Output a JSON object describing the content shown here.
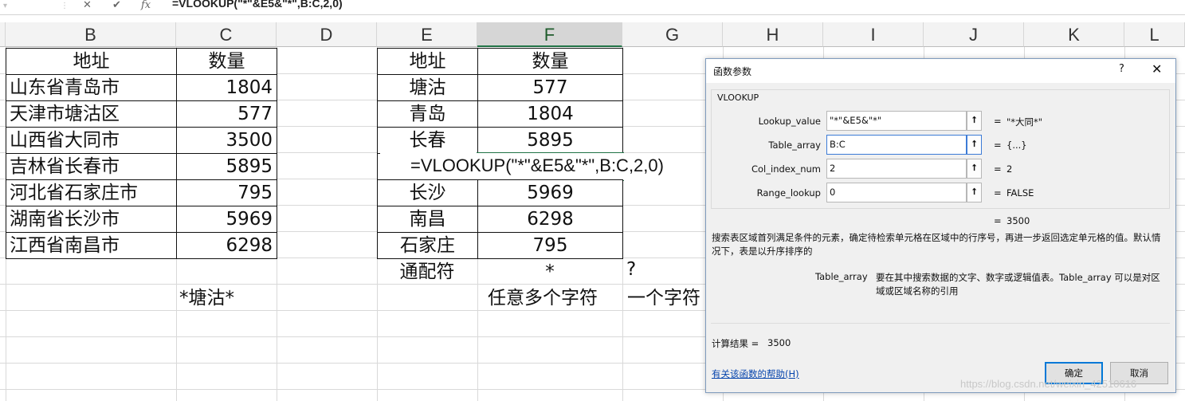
{
  "formula_bar": {
    "cancel_icon": "✕",
    "enter_icon": "✔",
    "fx_label": "fx",
    "formula": "=VLOOKUP(\"*\"&E5&\"*\",B:C,2,0)"
  },
  "columns": [
    "B",
    "C",
    "D",
    "E",
    "F",
    "G",
    "H",
    "I",
    "J",
    "K",
    "L"
  ],
  "table1": {
    "headers": [
      "地址",
      "数量"
    ],
    "rows": [
      [
        "山东省青岛市",
        "1804"
      ],
      [
        "天津市塘沽区",
        "577"
      ],
      [
        "山西省大同市",
        "3500"
      ],
      [
        "吉林省长春市",
        "5895"
      ],
      [
        "河北省石家庄市",
        "795"
      ],
      [
        "湖南省长沙市",
        "5969"
      ],
      [
        "江西省南昌市",
        "6298"
      ]
    ]
  },
  "table2": {
    "headers": [
      "地址",
      "数量"
    ],
    "rows": [
      [
        "塘沽",
        "577"
      ],
      [
        "青岛",
        "1804"
      ],
      [
        "长春",
        "5895"
      ],
      [
        "",
        "=VLOOKUP(\"*\"&E5&\"*\",B:C,2,0)"
      ],
      [
        "长沙",
        "5969"
      ],
      [
        "南昌",
        "6298"
      ],
      [
        "石家庄",
        "795"
      ]
    ]
  },
  "notes": {
    "wildcard_label": "通配符",
    "star": "*",
    "question": "?",
    "star_example": "*塘沽*",
    "star_meaning": "任意多个字符",
    "question_meaning": "一个字符"
  },
  "dialog": {
    "title": "函数参数",
    "help_icon": "?",
    "close_icon": "✕",
    "function_name": "VLOOKUP",
    "args": [
      {
        "label": "Lookup_value",
        "input": "\"*\"&E5&\"*\"",
        "eq": "=",
        "value": "\"*大同*\""
      },
      {
        "label": "Table_array",
        "input": "B:C",
        "eq": "=",
        "value": "{...}"
      },
      {
        "label": "Col_index_num",
        "input": "2",
        "eq": "=",
        "value": "2"
      },
      {
        "label": "Range_lookup",
        "input": "0",
        "eq": "=",
        "value": "FALSE"
      }
    ],
    "result_eq": "=",
    "result_value": "3500",
    "description": "搜索表区域首列满足条件的元素，确定待检索单元格在区域中的行序号，再进一步返回选定单元格的值。默认情况下，表是以升序排序的",
    "arg_help_name": "Table_array",
    "arg_help_text": "要在其中搜索数据的文字、数字或逻辑值表。Table_array 可以是对区域或区域名称的引用",
    "calc_label": "计算结果 =",
    "calc_value": "3500",
    "help_link": "有关该函数的帮助(H)",
    "ok_label": "确定",
    "cancel_label": "取消"
  },
  "watermark": "https://blog.csdn.net/weixin_42510616"
}
